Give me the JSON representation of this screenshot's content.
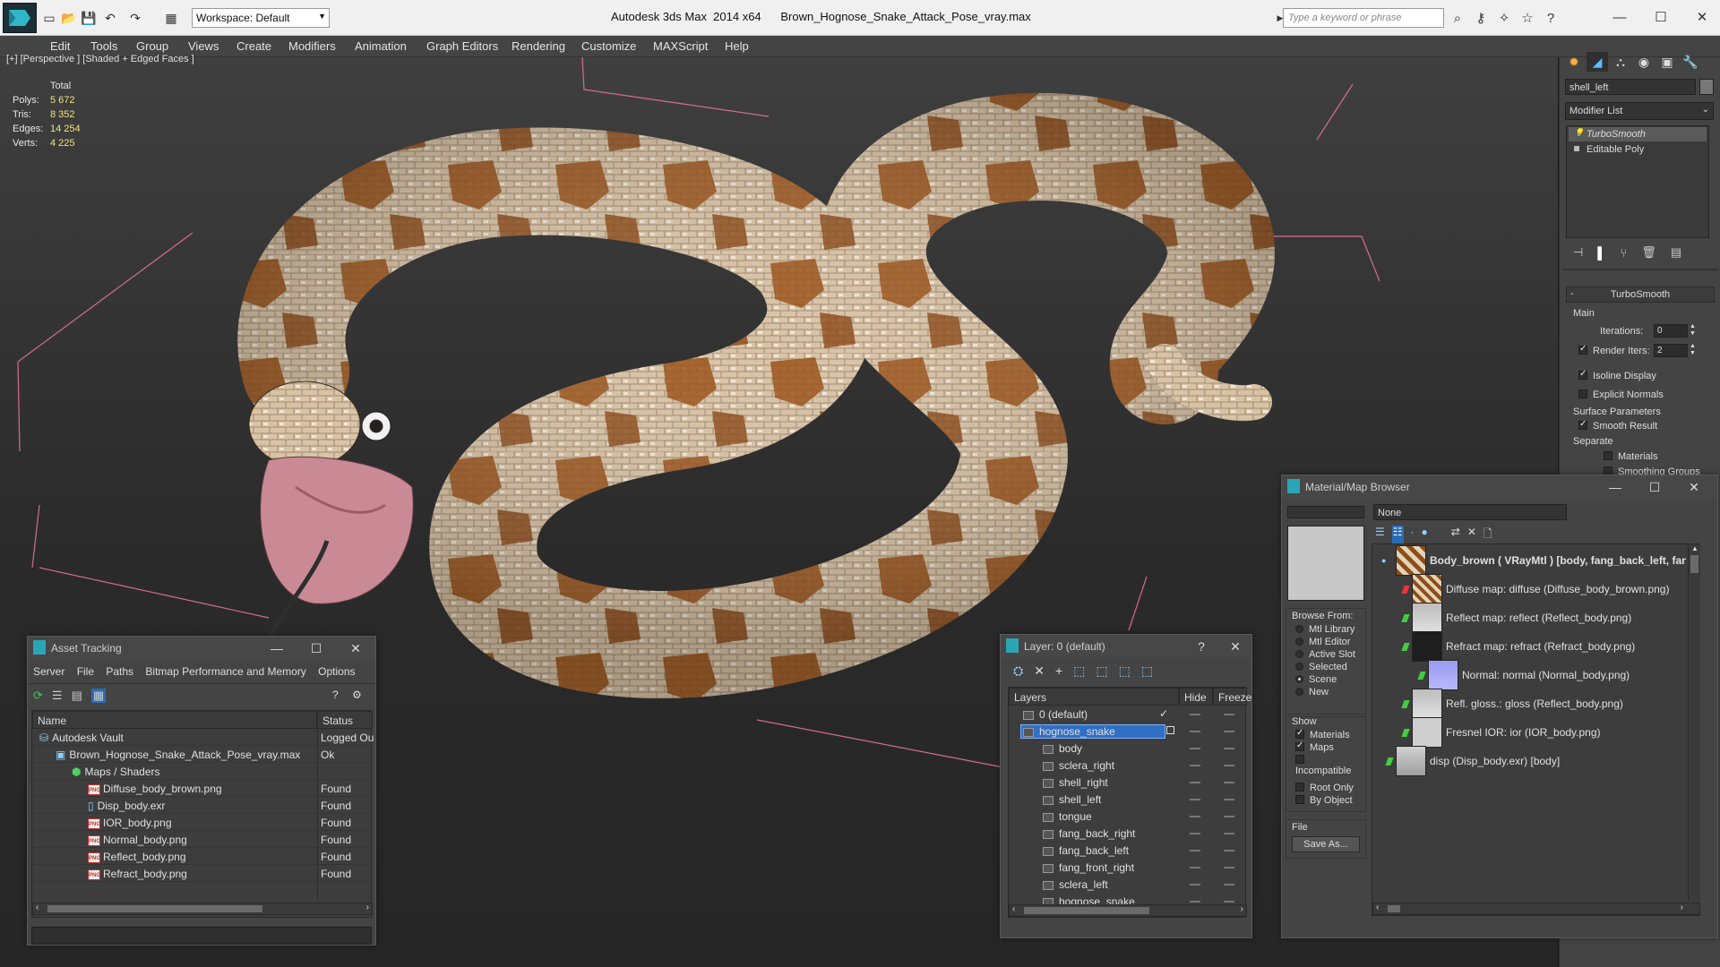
{
  "titlebar": {
    "workspace_label": "Workspace: Default",
    "app_name": "Autodesk 3ds Max  2014 x64",
    "file_name": "Brown_Hognose_Snake_Attack_Pose_vray.max",
    "search_placeholder": "Type a keyword or phrase"
  },
  "menu": [
    "Edit",
    "Tools",
    "Group",
    "Views",
    "Create",
    "Modifiers",
    "Animation",
    "Graph Editors",
    "Rendering",
    "Customize",
    "MAXScript",
    "Help"
  ],
  "viewport": {
    "label": "[+] [Perspective ] [Shaded + Edged Faces ]",
    "stats_header": "Total",
    "stats": [
      {
        "key": "Polys:",
        "value": "5 672"
      },
      {
        "key": "Tris:",
        "value": "8 352"
      },
      {
        "key": "Edges:",
        "value": "14 254"
      },
      {
        "key": "Verts:",
        "value": "4 225"
      }
    ]
  },
  "command_panel": {
    "object_name": "shell_left",
    "modifier_list": "Modifier List",
    "stack": [
      "TurboSmooth",
      "Editable Poly"
    ],
    "turbosmooth": {
      "title": "TurboSmooth",
      "main": "Main",
      "iterations_label": "Iterations:",
      "iterations_value": "0",
      "render_iters_label": "Render Iters:",
      "render_iters_value": "2",
      "isoline": "Isoline Display",
      "explicit_normals": "Explicit Normals",
      "surface_params": "Surface Parameters",
      "smooth_result": "Smooth Result",
      "separate": "Separate",
      "materials": "Materials",
      "smoothing_groups": "Smoothing Groups"
    }
  },
  "asset_tracking": {
    "title": "Asset Tracking",
    "menu": [
      "Server",
      "File",
      "Paths",
      "Bitmap Performance and Memory",
      "Options"
    ],
    "col_name": "Name",
    "col_status": "Status",
    "rows": [
      {
        "name": "Autodesk Vault",
        "status": "Logged Ou",
        "indent": 0,
        "icon": "vault"
      },
      {
        "name": "Brown_Hognose_Snake_Attack_Pose_vray.max",
        "status": "Ok",
        "indent": 1,
        "icon": "max"
      },
      {
        "name": "Maps / Shaders",
        "status": "",
        "indent": 2,
        "icon": "maps"
      },
      {
        "name": "Diffuse_body_brown.png",
        "status": "Found",
        "indent": 3,
        "icon": "png"
      },
      {
        "name": "Disp_body.exr",
        "status": "Found",
        "indent": 3,
        "icon": "exr"
      },
      {
        "name": "IOR_body.png",
        "status": "Found",
        "indent": 3,
        "icon": "png"
      },
      {
        "name": "Normal_body.png",
        "status": "Found",
        "indent": 3,
        "icon": "png"
      },
      {
        "name": "Reflect_body.png",
        "status": "Found",
        "indent": 3,
        "icon": "png"
      },
      {
        "name": "Refract_body.png",
        "status": "Found",
        "indent": 3,
        "icon": "png"
      }
    ]
  },
  "layer_dialog": {
    "title": "Layer: 0 (default)",
    "col_layers": "Layers",
    "col_hide": "Hide",
    "col_freeze": "Freeze",
    "rows": [
      {
        "name": "0 (default)",
        "indent": 0,
        "selected": false
      },
      {
        "name": "hognose_snake",
        "indent": 0,
        "selected": true
      },
      {
        "name": "body",
        "indent": 1,
        "selected": false
      },
      {
        "name": "sclera_right",
        "indent": 1,
        "selected": false
      },
      {
        "name": "shell_right",
        "indent": 1,
        "selected": false
      },
      {
        "name": "shell_left",
        "indent": 1,
        "selected": false
      },
      {
        "name": "tongue",
        "indent": 1,
        "selected": false
      },
      {
        "name": "fang_back_right",
        "indent": 1,
        "selected": false
      },
      {
        "name": "fang_back_left",
        "indent": 1,
        "selected": false
      },
      {
        "name": "fang_front_right",
        "indent": 1,
        "selected": false
      },
      {
        "name": "sclera_left",
        "indent": 1,
        "selected": false
      },
      {
        "name": "hognose_snake",
        "indent": 1,
        "selected": false
      }
    ]
  },
  "material_browser": {
    "title": "Material/Map Browser",
    "search_value": "None",
    "browse_from": "Browse From:",
    "browse_options": [
      "Mtl Library",
      "Mtl Editor",
      "Active Slot",
      "Selected",
      "Scene",
      "New"
    ],
    "browse_selected": "Scene",
    "show": "Show",
    "show_options": [
      {
        "label": "Materials",
        "checked": true
      },
      {
        "label": "Maps",
        "checked": true
      },
      {
        "label": "Incompatible",
        "checked": false
      }
    ],
    "root_only": "Root Only",
    "by_object": "By Object",
    "file": "File",
    "save_as": "Save As...",
    "tree": [
      {
        "label": "Body_brown  ( VRayMtl )  [body, fang_back_left, fan",
        "indent": 0,
        "bold": true,
        "thumb": "snake",
        "slot": "none"
      },
      {
        "label": "Diffuse map: diffuse (Diffuse_body_brown.png)",
        "indent": 1,
        "bold": false,
        "thumb": "diffuse",
        "slot": "red"
      },
      {
        "label": "Reflect map: reflect (Reflect_body.png)",
        "indent": 1,
        "bold": false,
        "thumb": "reflect",
        "slot": "green"
      },
      {
        "label": "Refract map: refract (Refract_body.png)",
        "indent": 1,
        "bold": false,
        "thumb": "refract",
        "slot": "green"
      },
      {
        "label": "Normal: normal (Normal_body.png)",
        "indent": 2,
        "bold": false,
        "thumb": "normal",
        "slot": "green"
      },
      {
        "label": "Refl. gloss.: gloss (Reflect_body.png)",
        "indent": 1,
        "bold": false,
        "thumb": "reflect",
        "slot": "green"
      },
      {
        "label": "Fresnel IOR: ior (IOR_body.png)",
        "indent": 1,
        "bold": false,
        "thumb": "ior",
        "slot": "green"
      },
      {
        "label": "disp (Disp_body.exr)  [body]",
        "indent": 0,
        "bold": false,
        "thumb": "disp",
        "slot": "green"
      }
    ]
  }
}
